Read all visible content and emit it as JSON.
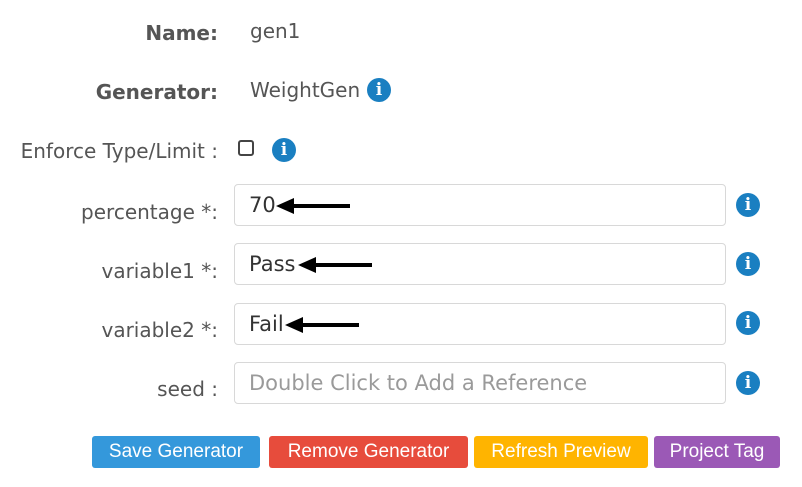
{
  "form": {
    "name_label": "Name:",
    "name_value": "gen1",
    "generator_label": "Generator:",
    "generator_value": "WeightGen",
    "enforce_label": "Enforce Type/Limit :",
    "enforce_checked": false,
    "percentage_label": "percentage *:",
    "percentage_value": "70",
    "variable1_label": "variable1 *:",
    "variable1_value": "Pass",
    "variable2_label": "variable2 *:",
    "variable2_value": "Fail",
    "seed_label": "seed :",
    "seed_placeholder": "Double Click to Add a Reference"
  },
  "icons": {
    "info_glyph": "i"
  },
  "buttons": {
    "save": "Save Generator",
    "remove": "Remove Generator",
    "refresh": "Refresh Preview",
    "project_tag": "Project Tag"
  },
  "colors": {
    "info": "#1a7fc1",
    "save": "#3498db",
    "remove": "#e74c3c",
    "refresh": "#ffb400",
    "project_tag": "#9b59b6"
  }
}
